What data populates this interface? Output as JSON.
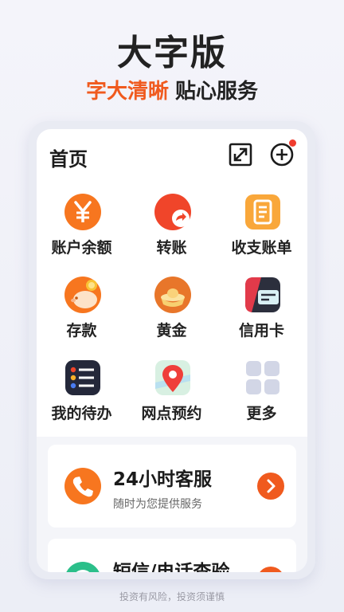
{
  "promo": {
    "headline": "大字版",
    "tagline_accent": "字大清晰",
    "tagline_rest": "贴心服务"
  },
  "app": {
    "page_title": "首页",
    "topbar_icons": [
      "expand-icon",
      "add-circle-icon"
    ],
    "grid": [
      {
        "label": "账户余额",
        "icon": "yen-coin-icon"
      },
      {
        "label": "转账",
        "icon": "transfer-arrow-icon"
      },
      {
        "label": "收支账单",
        "icon": "bill-document-icon"
      },
      {
        "label": "存款",
        "icon": "piggy-bank-icon"
      },
      {
        "label": "黄金",
        "icon": "gold-ingot-icon"
      },
      {
        "label": "信用卡",
        "icon": "credit-card-icon"
      },
      {
        "label": "我的待办",
        "icon": "todo-list-icon"
      },
      {
        "label": "网点预约",
        "icon": "map-pin-icon"
      },
      {
        "label": "更多",
        "icon": "more-grid-icon"
      }
    ],
    "cards": [
      {
        "title": "24小时客服",
        "subtitle": "随时为您提供服务",
        "icon": "phone-icon"
      },
      {
        "title": "短信/电话查验",
        "subtitle": "",
        "icon": "message-check-icon"
      }
    ]
  },
  "footer": {
    "disclaimer": "投资有风险，投资须谨慎"
  },
  "colors": {
    "accent": "#f05a1e",
    "orange_icon": "#f7761f",
    "red_dot": "#f03c2e",
    "dark_text": "#222222"
  }
}
